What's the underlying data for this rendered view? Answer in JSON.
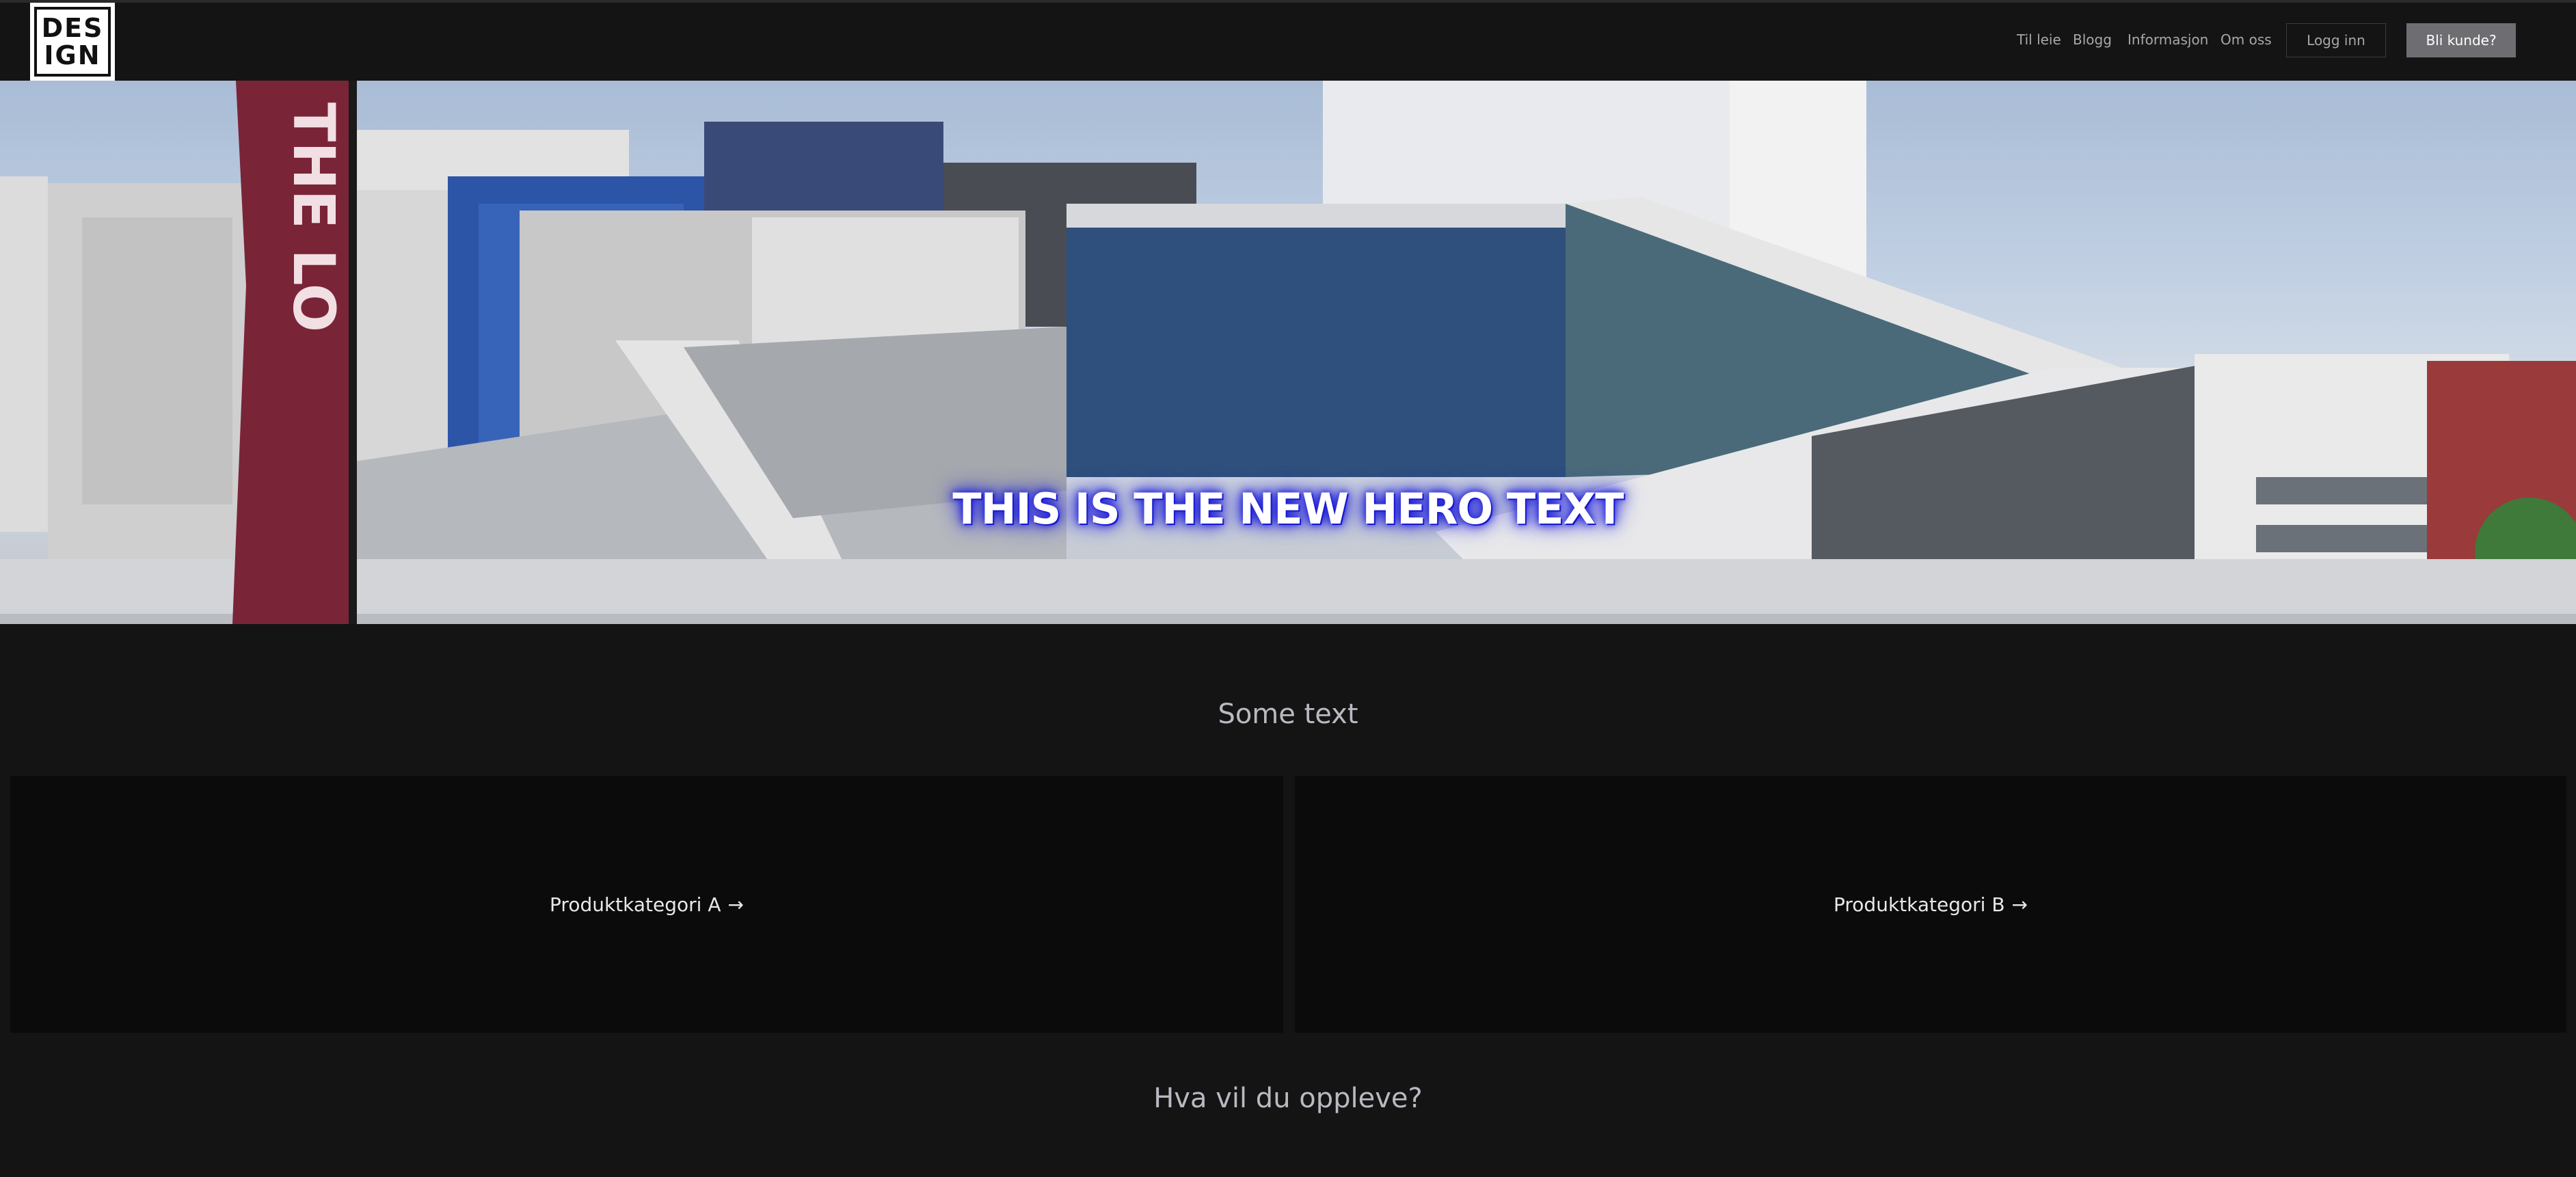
{
  "logo": {
    "line1": "DES",
    "line2": "IGN"
  },
  "nav": {
    "links": [
      "Til leie",
      "Blogg",
      "Informasjon",
      "Om oss"
    ],
    "login_label": "Logg inn",
    "cta_label": "Bli kunde?"
  },
  "hero": {
    "text": "THIS IS THE NEW HERO TEXT",
    "flag_text": "THE LO"
  },
  "section1": {
    "title": "Some text"
  },
  "categories": [
    {
      "label": "Produktkategori A",
      "arrow": "→"
    },
    {
      "label": "Produktkategori B",
      "arrow": "→"
    }
  ],
  "section2": {
    "title": "Hva vil du oppleve?"
  },
  "colors": {
    "background": "#141414",
    "card": "#0b0b0b",
    "cta": "#6e6e72",
    "hero_glow": "#1a1ad8"
  }
}
